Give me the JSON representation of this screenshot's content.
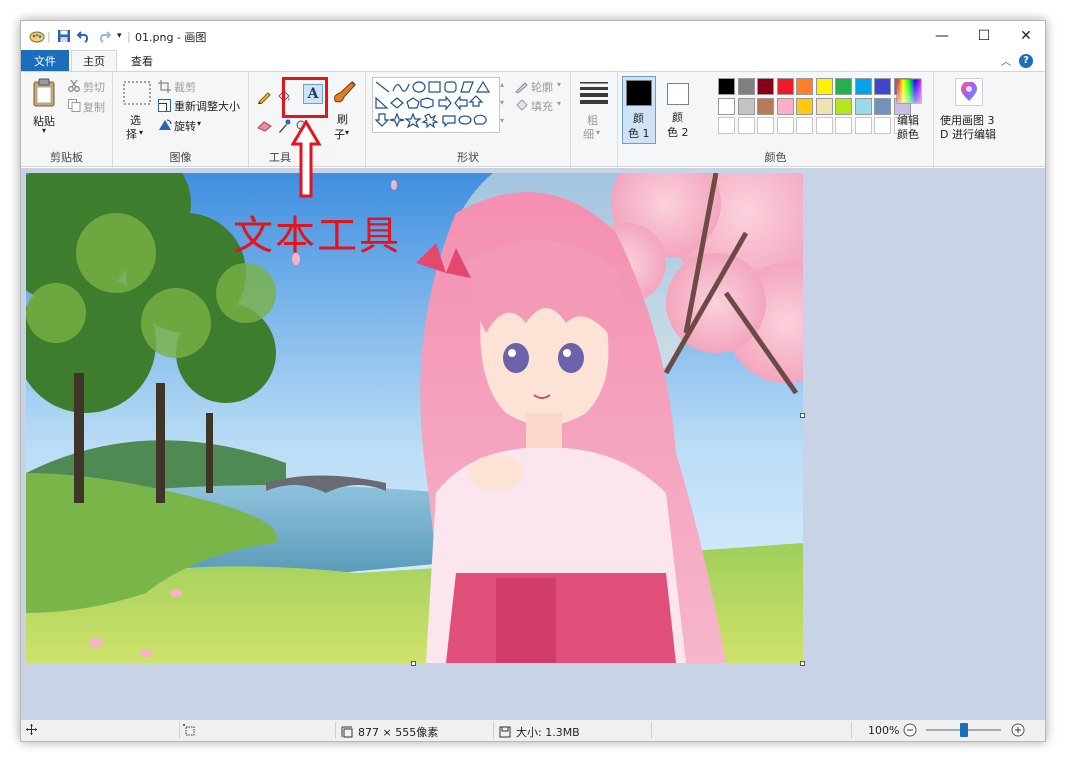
{
  "window": {
    "title": "01.png - 画图"
  },
  "tabs": {
    "file": "文件",
    "home": "主页",
    "view": "查看"
  },
  "clipboard": {
    "paste": "粘贴",
    "cut": "剪切",
    "copy": "复制",
    "label": "剪贴板"
  },
  "image": {
    "select_1": "选",
    "select_2": "择",
    "crop": "裁剪",
    "resize": "重新调整大小",
    "rotate": "旋转",
    "label": "图像"
  },
  "tools": {
    "label": "工具",
    "brush_1": "刷",
    "brush_2": "子",
    "text_icon": "A"
  },
  "shapes": {
    "outline": "轮廓",
    "fill": "填充",
    "label": "形状"
  },
  "size": {
    "label_1": "粗",
    "label_2": "细"
  },
  "colors": {
    "color1_1": "颜",
    "color1_2": "色 1",
    "color2_1": "颜",
    "color2_2": "色 2",
    "edit_1": "编辑",
    "edit_2": "颜色",
    "label": "颜色",
    "paint3d_1": "使用画图 3",
    "paint3d_2": "D 进行编辑",
    "primary": "#000000",
    "secondary": "#ffffff",
    "palette_row1": [
      "#000000",
      "#7f7f7f",
      "#880015",
      "#ed1c24",
      "#ff7f27",
      "#fff200",
      "#22b14c",
      "#00a2e8",
      "#3f48cc",
      "#a349a4"
    ],
    "palette_row2": [
      "#ffffff",
      "#c3c3c3",
      "#b97a57",
      "#ffaec9",
      "#ffc90e",
      "#efe4b0",
      "#b5e61d",
      "#99d9ea",
      "#7092be",
      "#c8bfe7"
    ]
  },
  "annotation": {
    "text": "文本工具",
    "color": "#e3141d"
  },
  "status": {
    "dimensions": "877 × 555像素",
    "file_size": "大小: 1.3MB",
    "zoom": "100%"
  },
  "zoom_level": 0.5
}
